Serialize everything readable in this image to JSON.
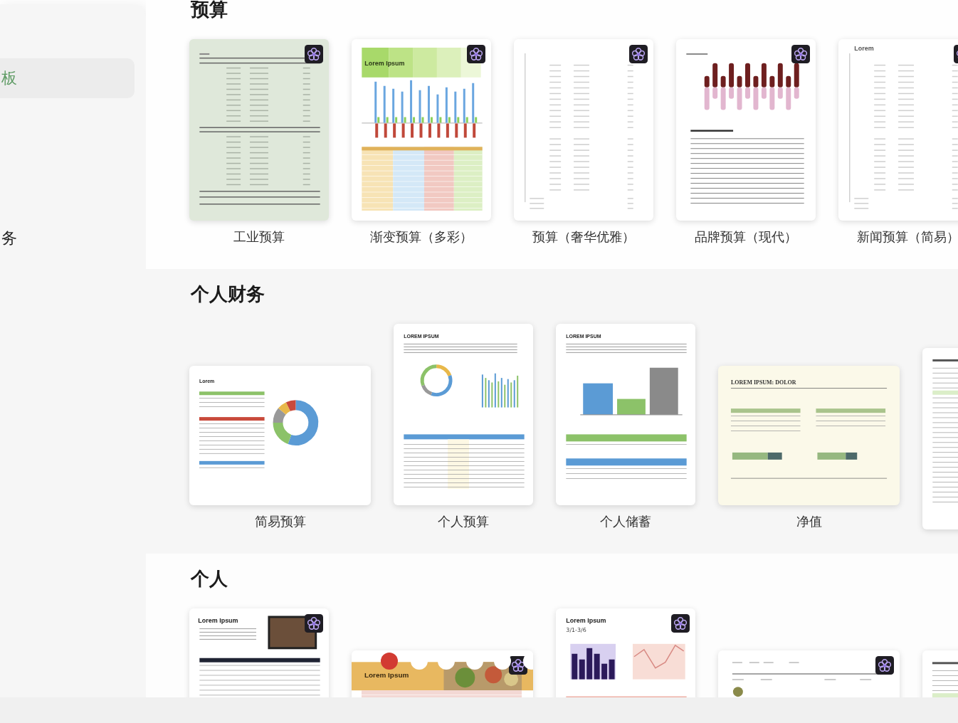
{
  "sidebar": {
    "items": [
      {
        "label": "板",
        "selected": true
      },
      {
        "label": "务",
        "selected": false
      }
    ]
  },
  "sections": [
    {
      "title": "预算",
      "templates": [
        {
          "label": "工业预算",
          "kind": "ledger",
          "landscape": false,
          "badge": true
        },
        {
          "label": "渐变预算（多彩）",
          "kind": "gradient",
          "landscape": false,
          "badge": true,
          "preview_title": "Lorem Ipsum"
        },
        {
          "label": "预算（奢华优雅）",
          "kind": "sparse",
          "landscape": false,
          "badge": true
        },
        {
          "label": "品牌预算（现代）",
          "kind": "brand",
          "landscape": false,
          "badge": true
        },
        {
          "label": "新闻预算（简易）",
          "kind": "news",
          "landscape": false,
          "badge": true,
          "preview_title": "Lorem"
        }
      ]
    },
    {
      "title": "个人财务",
      "templates": [
        {
          "label": "简易预算",
          "kind": "donut",
          "landscape": true,
          "badge": false,
          "preview_title": "Lorem"
        },
        {
          "label": "个人预算",
          "kind": "summary",
          "landscape": false,
          "badge": false,
          "preview_title": "LOREM IPSUM"
        },
        {
          "label": "个人储蓄",
          "kind": "savings",
          "landscape": false,
          "badge": false,
          "preview_title": "LOREM IPSUM"
        },
        {
          "label": "净值",
          "kind": "networth",
          "landscape": true,
          "badge": false,
          "preview_title": "LOREM IPSUM: DOLOR"
        },
        {
          "kind": "list",
          "landscape": false,
          "badge": false
        }
      ]
    },
    {
      "title": "个人",
      "templates": [
        {
          "kind": "photo",
          "landscape": false,
          "badge": true,
          "preview_title": "Lorem Ipsum"
        },
        {
          "kind": "banner",
          "landscape": true,
          "badge": true,
          "preview_title": "Lorem Ipsum"
        },
        {
          "kind": "dashboard",
          "landscape": false,
          "badge": true,
          "preview_title": "Lorem Ipsum",
          "preview_subtitle": "3/1-3/6"
        },
        {
          "kind": "bill",
          "landscape": true,
          "badge": true
        },
        {
          "kind": "list",
          "landscape": true,
          "badge": false
        }
      ]
    }
  ]
}
